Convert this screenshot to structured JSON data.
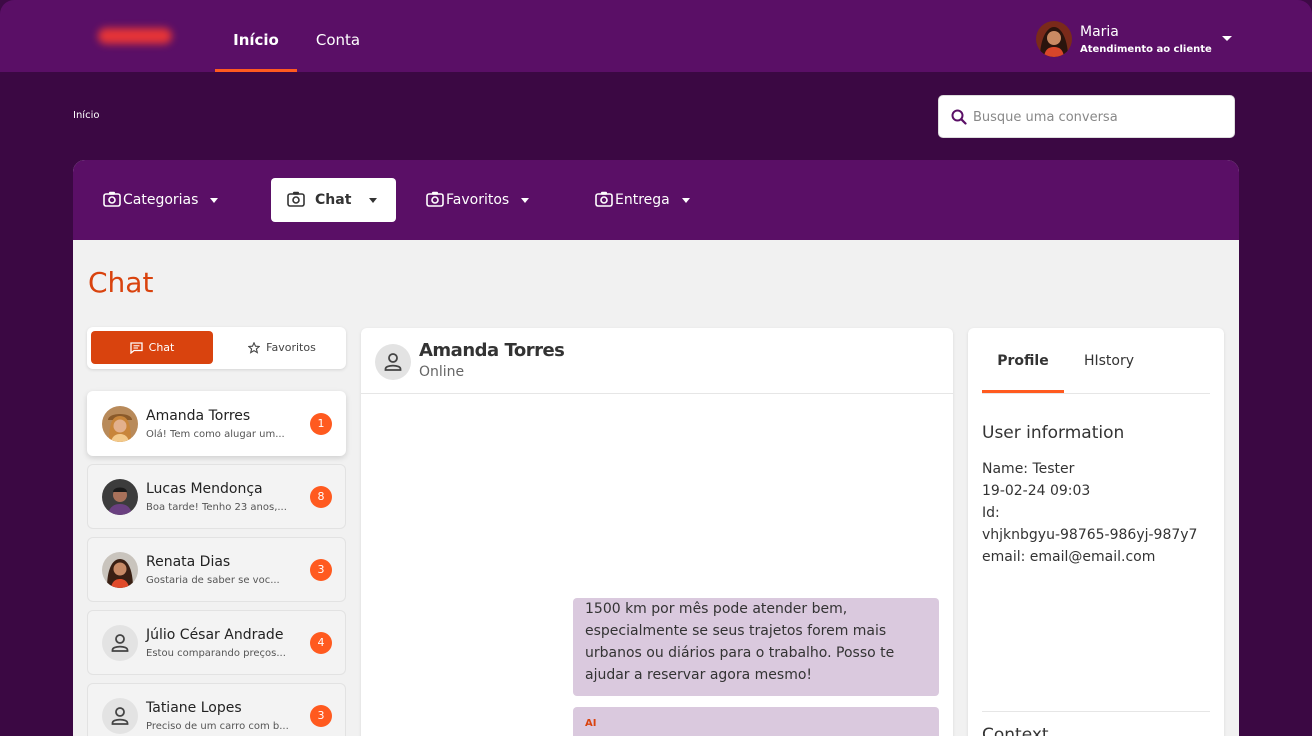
{
  "nav": {
    "items": [
      {
        "label": "Início",
        "active": true
      },
      {
        "label": "Conta",
        "active": false
      }
    ]
  },
  "user": {
    "name": "Maria",
    "role": "Atendimento ao cliente"
  },
  "breadcrumb": "Início",
  "search": {
    "placeholder": "Busque uma conversa"
  },
  "categories": [
    {
      "label": "Categorias",
      "active": false
    },
    {
      "label": "Chat",
      "active": true
    },
    {
      "label": "Favoritos",
      "active": false
    },
    {
      "label": "Entrega",
      "active": false
    }
  ],
  "page_title": "Chat",
  "segment": {
    "chat_label": "Chat",
    "favorites_label": "Favoritos"
  },
  "conversations": [
    {
      "name": "Amanda Torres",
      "preview": "Olá! Tem como alugar um...",
      "count": "1",
      "selected": true
    },
    {
      "name": "Lucas Mendonça",
      "preview": "Boa tarde! Tenho 23 anos,...",
      "count": "8",
      "selected": false
    },
    {
      "name": "Renata Dias",
      "preview": " Gostaria de saber se voc...",
      "count": "3",
      "selected": false
    },
    {
      "name": "Júlio César Andrade",
      "preview": "Estou comparando preços...",
      "count": "4",
      "selected": false
    },
    {
      "name": "Tatiane Lopes",
      "preview": "Preciso de um carro com b...",
      "count": "3",
      "selected": false
    }
  ],
  "chat": {
    "contact_name": "Amanda Torres",
    "status": "Online",
    "messages": [
      {
        "lines": [
          "1500 km por mês pode atender bem,",
          "especialmente se seus trajetos forem mais",
          "urbanos ou diários para o trabalho. Posso te",
          "ajudar a reservar agora mesmo!"
        ]
      },
      {
        "sender": "AI"
      }
    ]
  },
  "profile": {
    "tabs": [
      {
        "label": "Profile",
        "active": true
      },
      {
        "label": "HIstory",
        "active": false
      }
    ],
    "heading": "User information",
    "lines": [
      "Name: Tester",
      "19-02-24 09:03",
      "Id:",
      "vhjknbgyu-98765-986yj-987y7",
      "email: email@email.com"
    ],
    "context_heading": "Context"
  },
  "colors": {
    "brand_purple": "#5a0f66",
    "accent_orange": "#ff5a1f",
    "title_orange": "#d9430e",
    "bubble": "#dac9de"
  }
}
